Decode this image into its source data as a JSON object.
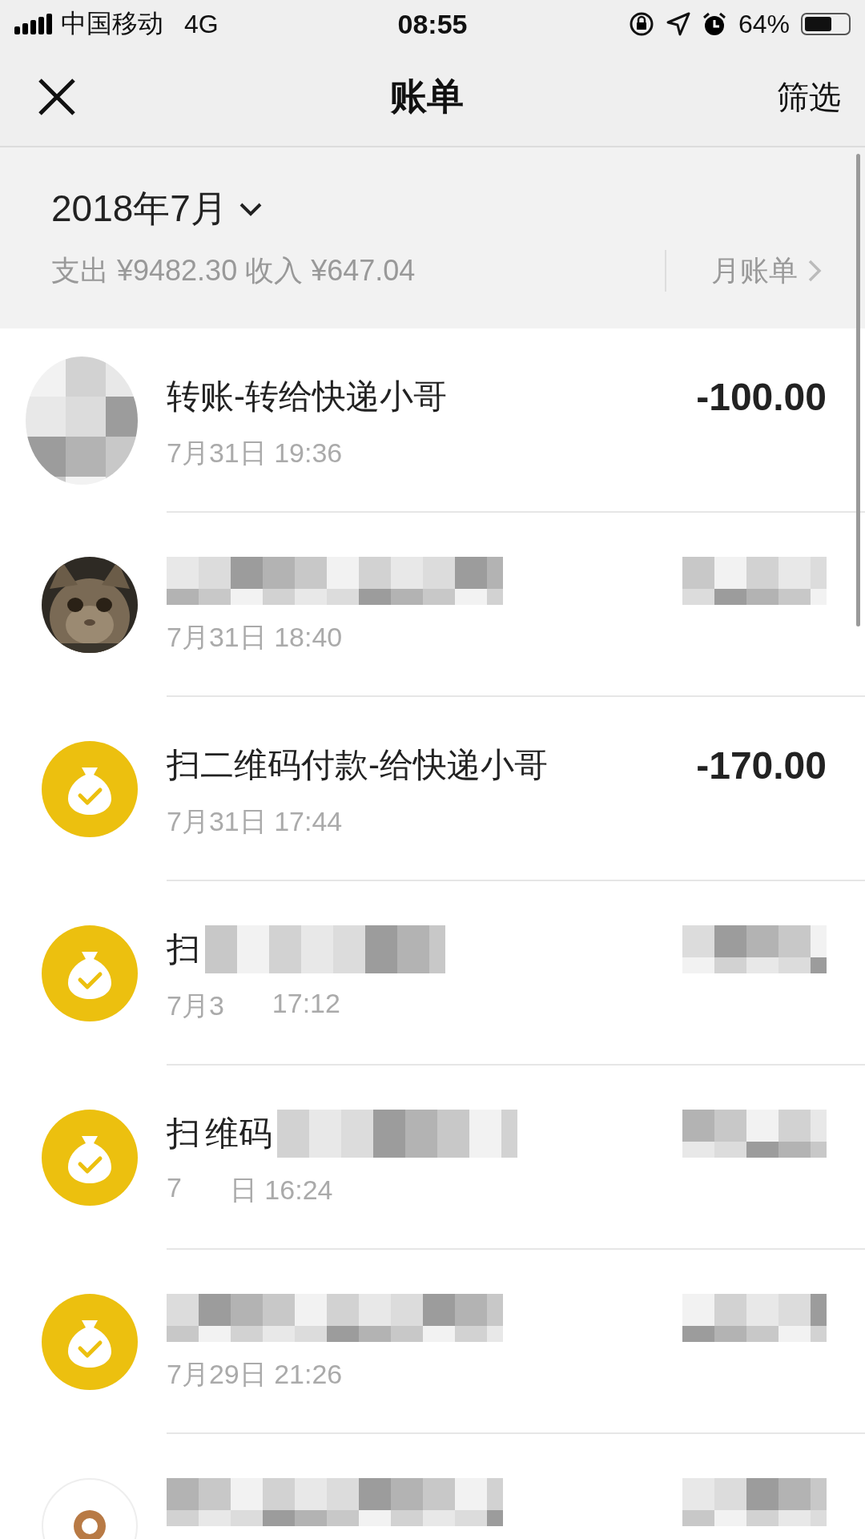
{
  "status_bar": {
    "carrier": "中国移动",
    "network": "4G",
    "time": "08:55",
    "battery": "64%"
  },
  "nav": {
    "title": "账单",
    "action": "筛选"
  },
  "month": {
    "label": "2018年7月",
    "summary": "支出 ¥9482.30 收入 ¥647.04",
    "monthly_bill": "月账单"
  },
  "rows": [
    {
      "kind": "mosaic",
      "title": [
        "转账-转给快递小哥"
      ],
      "title_masked": false,
      "time": [
        "7月31日 19:36"
      ],
      "amount": "-100.00",
      "amount_masked": false
    },
    {
      "title_masked": true,
      "time": [
        "7月31日 18:40"
      ],
      "amount_masked": true
    },
    {
      "kind": "money",
      "title": [
        "扫二维码付款-给快递小哥"
      ],
      "title_masked": false,
      "time": [
        "7月31日 17:44"
      ],
      "amount": "-170.00",
      "amount_masked": false
    },
    {
      "kind": "money",
      "title": [
        "扫"
      ],
      "title_masked": true,
      "time": [
        "7月3",
        "17:12"
      ],
      "amount_masked": true
    },
    {
      "kind": "money",
      "title": [
        "扫",
        "维码"
      ],
      "title_masked": true,
      "time": [
        "7",
        "日 16:24"
      ],
      "amount_masked": true
    },
    {
      "kind": "money",
      "title_masked": true,
      "time": [
        "7月29日 21:26"
      ],
      "amount_masked": true
    },
    {
      "kind": "logo",
      "title_masked": true,
      "amount_masked": true
    }
  ]
}
